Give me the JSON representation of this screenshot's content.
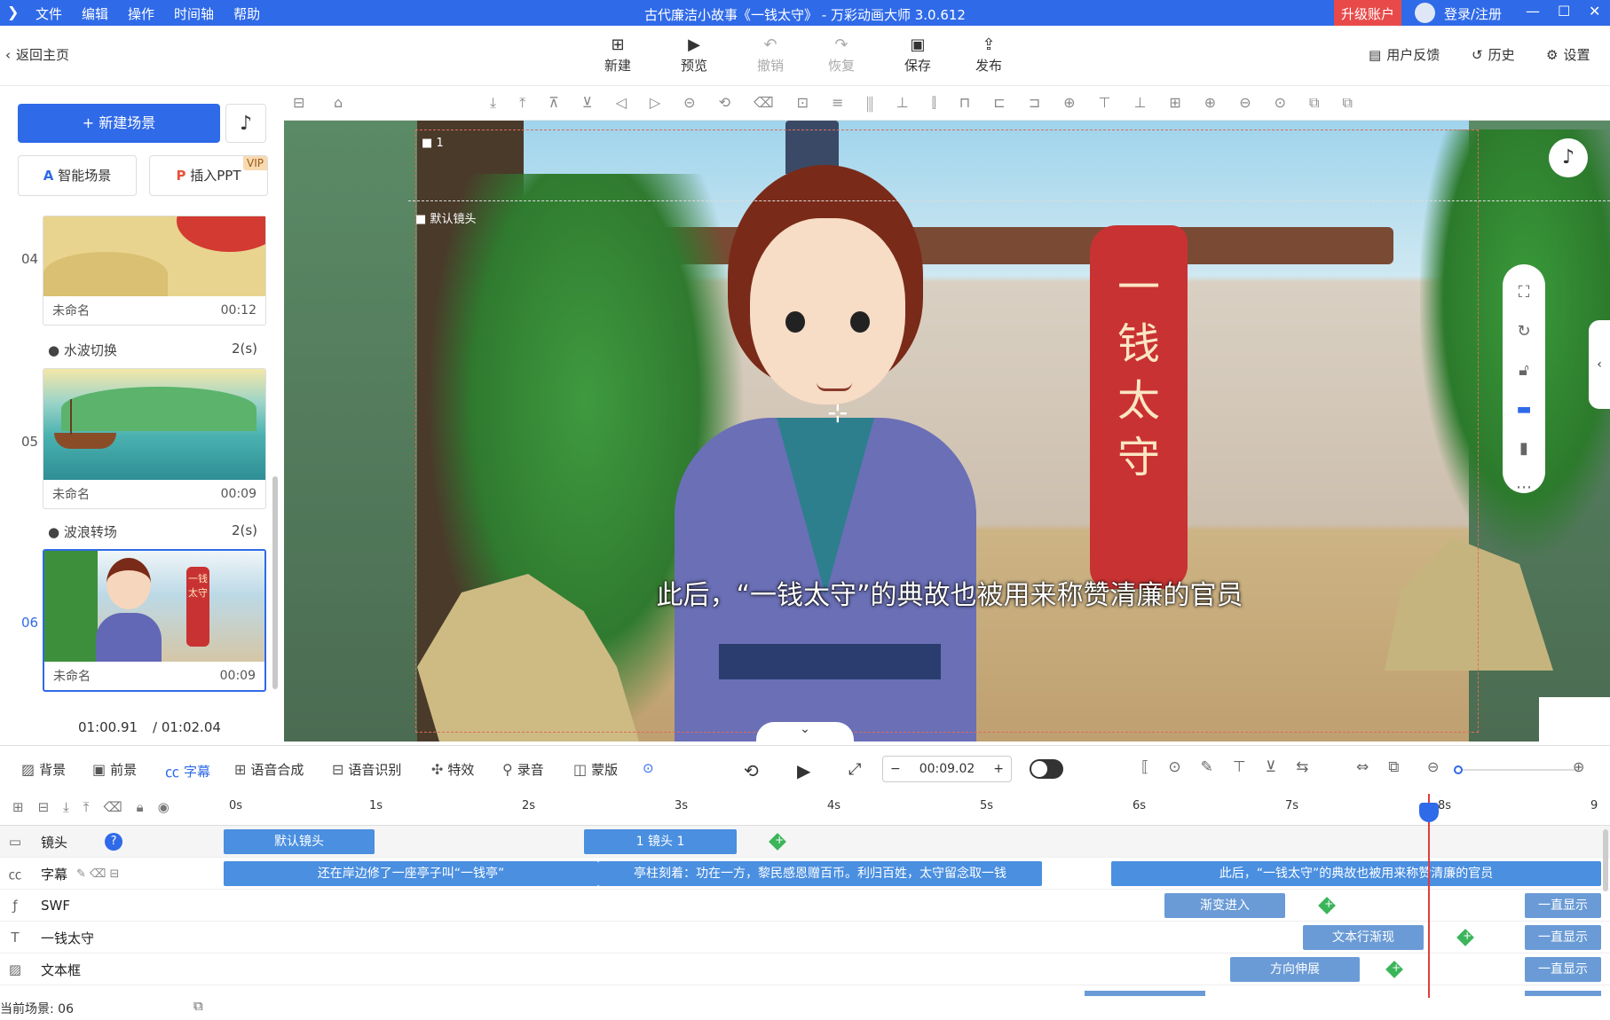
{
  "titlebar": {
    "menu": [
      "文件",
      "编辑",
      "操作",
      "时间轴",
      "帮助"
    ],
    "title": "古代廉洁小故事《一钱太守》 - 万彩动画大师 3.0.612",
    "upgrade": "升级账户",
    "login": "登录/注册"
  },
  "toolbar": {
    "back": "返回主页",
    "new": "新建",
    "preview": "预览",
    "undo": "撤销",
    "redo": "恢复",
    "save": "保存",
    "publish": "发布",
    "feedback": "用户反馈",
    "history": "历史",
    "settings": "设置"
  },
  "left": {
    "new_scene": "+ 新建场景",
    "smart_scene": "智能场景",
    "insert_ppt": "插入PPT",
    "vip": "VIP",
    "scenes": [
      {
        "num": "04",
        "name": "未命名",
        "dur": "00:12"
      },
      {
        "num": "05",
        "name": "未命名",
        "dur": "00:09"
      },
      {
        "num": "06",
        "name": "未命名",
        "dur": "00:09"
      }
    ],
    "transitions": [
      {
        "name": "水波切换",
        "dur": "2(s)"
      },
      {
        "name": "波浪转场",
        "dur": "2(s)"
      }
    ],
    "time_current": "01:00.91",
    "time_total": "/ 01:02.04"
  },
  "canvas": {
    "cam_index": "1",
    "cam_label": "默认镜头",
    "banner": [
      "一",
      "钱",
      "太",
      "守"
    ],
    "subtitle": "此后，“一钱太守”的典故也被用来称赞清廉的官员",
    "thumb_banner": "一钱太守"
  },
  "bottombar": {
    "bg": "背景",
    "fg": "前景",
    "caption": "字幕",
    "tts": "语音合成",
    "asr": "语音识别",
    "fx": "特效",
    "rec": "录音",
    "mask": "蒙版",
    "time": "00:09.02"
  },
  "timeline": {
    "ticks": [
      "0s",
      "1s",
      "2s",
      "3s",
      "4s",
      "5s",
      "6s",
      "7s",
      "8s",
      "9"
    ],
    "rows": [
      {
        "label": "镜头",
        "clips": [
          "默认镜头",
          "1 镜头 1"
        ]
      },
      {
        "label": "字幕",
        "clips": [
          "还在岸边修了一座亭子叫“一钱亭”",
          "亭柱刻着：功在一方，黎民感恩赠百币。利归百姓，太守留念取一钱",
          "此后，“一钱太守”的典故也被用来称赞清廉的官员"
        ]
      },
      {
        "label": "SWF",
        "clips": [
          "渐变进入",
          "一直显示"
        ]
      },
      {
        "label": "一钱太守",
        "clips": [
          "文本行渐现",
          "一直显示"
        ]
      },
      {
        "label": "文本框",
        "clips": [
          "方向伸展",
          "一直显示"
        ]
      }
    ],
    "current_scene": "当前场景: 06"
  }
}
